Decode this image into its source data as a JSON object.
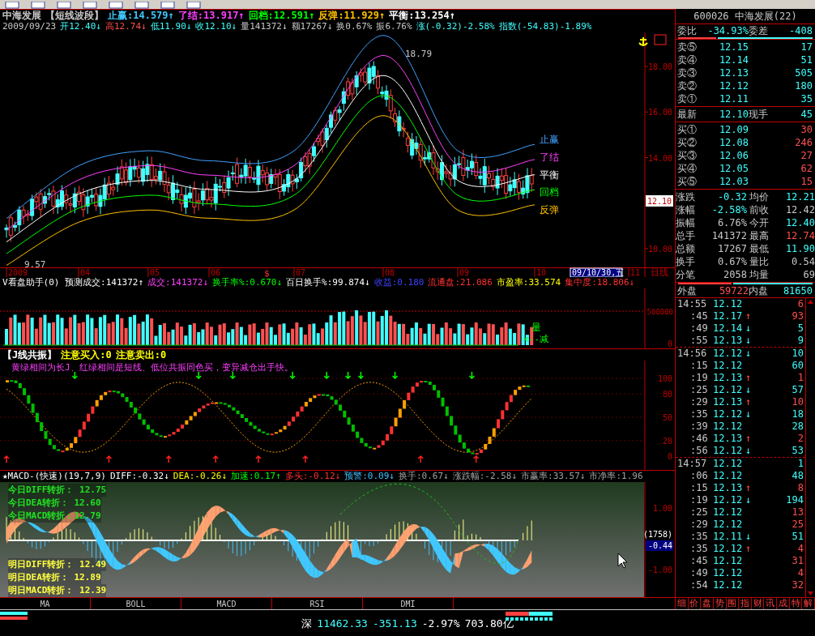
{
  "header": {
    "title": [
      {
        "text": "中海发展",
        "color": "#c8c8c8"
      },
      {
        "text": "【短线波段】",
        "color": "#c8c8c8"
      },
      {
        "text": "止赢:14.579↑",
        "color": "#40c8ff"
      },
      {
        "text": "了结:13.917↑",
        "color": "#ff40ff"
      },
      {
        "text": "回档:12.591↑",
        "color": "#00ff00"
      },
      {
        "text": "反弹:11.929↑",
        "color": "#ffc000"
      },
      {
        "text": "平衡:13.254↑",
        "color": "#ffffff"
      }
    ],
    "info": [
      {
        "text": "2009/09/23",
        "color": "#c8c8c8"
      },
      {
        "text": "开12.40↓",
        "color": "#40ffff"
      },
      {
        "text": "高12.74↓",
        "color": "#ff5050"
      },
      {
        "text": "低11.90↓",
        "color": "#40ffff"
      },
      {
        "text": "收12.10↓",
        "color": "#40ffff"
      },
      {
        "text": "量141372↓",
        "color": "#c8c8c8"
      },
      {
        "text": "额17267↓",
        "color": "#c8c8c8"
      },
      {
        "text": "换0.67%",
        "color": "#c8c8c8"
      },
      {
        "text": "振6.76%",
        "color": "#c8c8c8"
      },
      {
        "text": "涨(-0.32)-2.58%",
        "color": "#40ffff"
      },
      {
        "text": "指数(-54.83)-1.89%",
        "color": "#40ffff"
      }
    ]
  },
  "price_chart": {
    "high_label": "18.79",
    "low_label": "9.57",
    "current_price": "12.10",
    "y_ticks": [
      "18.00",
      "16.00",
      "14.00",
      "10.00"
    ],
    "band_labels": [
      {
        "text": "止赢",
        "color": "#40a0ff"
      },
      {
        "text": "了结",
        "color": "#ff40ff"
      },
      {
        "text": "平衡",
        "color": "#ffffff"
      },
      {
        "text": "回档",
        "color": "#00ff00"
      },
      {
        "text": "反弹",
        "color": "#ffc000"
      }
    ]
  },
  "date_axis": {
    "labels": [
      "2009",
      "04",
      "05",
      "06",
      "07",
      "08",
      "09",
      "10"
    ],
    "marker": "$",
    "cursor_date": "09/10/30,五",
    "last_label": "11",
    "period": "日线"
  },
  "volume_panel": {
    "header": [
      {
        "text": "V看盘助手(0) 预测成交:141372↑",
        "color": "#ffffff"
      },
      {
        "text": "成交:141372↓",
        "color": "#ff40ff"
      },
      {
        "text": "换手率%:0.670↓",
        "color": "#00ff00"
      },
      {
        "text": "百日换手%:99.874↓",
        "color": "#ffffff"
      },
      {
        "text": "收益:0.180",
        "color": "#4040ff"
      },
      {
        "text": "流通盘:21.086",
        "color": "#ff3030"
      },
      {
        "text": "市盈率:33.574",
        "color": "#ffff00"
      },
      {
        "text": "集中度:18.806↓",
        "color": "#ff3030"
      }
    ],
    "y_ticks": [
      "500000",
      "0"
    ],
    "side_label": "量",
    "side_hint": "<--减"
  },
  "j_panel": {
    "header": [
      {
        "text": "【J线共振】",
        "color": "#ffffff"
      },
      {
        "text": "注意买入:0",
        "color": "#ffff00"
      },
      {
        "text": "注意卖出:0",
        "color": "#ffff00"
      }
    ],
    "note": "黄绿相间为长J、红绿相间是短线、低位共振同色买，变异减仓出手快。",
    "y_ticks": [
      "100",
      "80",
      "50",
      "20",
      "0"
    ]
  },
  "macd_panel": {
    "header": [
      {
        "text": "★MACD-(快速)(19,7,9)",
        "color": "#ffffff"
      },
      {
        "text": "DIFF:-0.32↓",
        "color": "#ffffff"
      },
      {
        "text": "DEA:-0.26↓",
        "color": "#ffff00"
      },
      {
        "text": "加速:0.17↑",
        "color": "#00ff00"
      },
      {
        "text": "多头:-0.12↓",
        "color": "#ff3030"
      },
      {
        "text": "预警:0.09↓",
        "color": "#40c0ff"
      },
      {
        "text": "换手:0.67↓",
        "color": "#a0a0a0"
      },
      {
        "text": "涨跌幅:-2.58↓",
        "color": "#a0a0a0"
      },
      {
        "text": "市赢率:33.57↓",
        "color": "#a0a0a0"
      },
      {
        "text": "市净率:1.96",
        "color": "#a0a0a0"
      }
    ],
    "today": [
      "今日DIFF转折： 12.75",
      "今日DEA转折： 12.60",
      "今日MACD转折：12.79"
    ],
    "tomorrow": [
      "明日DIFF转折： 12.49",
      "明日DEA转折： 12.89",
      "明日MACD转折： 12.39"
    ],
    "y_ticks": [
      "1.00",
      "-1.00"
    ],
    "count": "(1758)",
    "current": "-0.44"
  },
  "indicator_tabs": [
    {
      "label": "MA",
      "selected": false
    },
    {
      "label": "BOLL",
      "selected": false
    },
    {
      "label": "MACD",
      "selected": false
    },
    {
      "label": "RSI",
      "selected": false
    },
    {
      "label": "DMI",
      "selected": false
    }
  ],
  "quote": {
    "code": "600026",
    "name": "中海发展(22)",
    "ratio": [
      "委比",
      "-34.93%",
      "委差",
      "-408"
    ],
    "asks": [
      {
        "label": "卖⑤",
        "price": "12.15",
        "volume": "17"
      },
      {
        "label": "卖④",
        "price": "12.14",
        "volume": "51"
      },
      {
        "label": "卖③",
        "price": "12.13",
        "volume": "505"
      },
      {
        "label": "卖②",
        "price": "12.12",
        "volume": "180"
      },
      {
        "label": "卖①",
        "price": "12.11",
        "volume": "35"
      }
    ],
    "latest": [
      "最新",
      "12.10",
      "现手",
      "45"
    ],
    "bids": [
      {
        "label": "买①",
        "price": "12.09",
        "volume": "30"
      },
      {
        "label": "买②",
        "price": "12.08",
        "volume": "246"
      },
      {
        "label": "买③",
        "price": "12.06",
        "volume": "27"
      },
      {
        "label": "买④",
        "price": "12.05",
        "volume": "62"
      },
      {
        "label": "买⑤",
        "price": "12.03",
        "volume": "15"
      }
    ],
    "stats": [
      {
        "label": "涨跌",
        "value": "-0.32",
        "color": "#40ffff"
      },
      {
        "label": "均价",
        "value": "12.21",
        "color": "#40ffff"
      },
      {
        "label": "涨幅",
        "value": "-2.58%",
        "color": "#40ffff"
      },
      {
        "label": "前收",
        "value": "12.42",
        "color": "#c8c8c8"
      },
      {
        "label": "振幅",
        "value": "6.76%",
        "color": "#c8c8c8"
      },
      {
        "label": "今开",
        "value": "12.40",
        "color": "#40ffff"
      },
      {
        "label": "总手",
        "value": "141372",
        "color": "#c8c8c8"
      },
      {
        "label": "最高",
        "value": "12.74",
        "color": "#ff5050"
      },
      {
        "label": "总额",
        "value": "17267",
        "color": "#c8c8c8"
      },
      {
        "label": "最低",
        "value": "11.90",
        "color": "#40ffff"
      },
      {
        "label": "换手",
        "value": "0.67%",
        "color": "#c8c8c8"
      },
      {
        "label": "量比",
        "value": "0.54",
        "color": "#c8c8c8"
      },
      {
        "label": "分笔",
        "value": "2058",
        "color": "#c8c8c8"
      },
      {
        "label": "均量",
        "value": "69",
        "color": "#c8c8c8"
      }
    ],
    "outer": [
      "外盘",
      "59722",
      "内盘",
      "81650"
    ],
    "tick_groups": [
      {
        "rows": [
          {
            "time": "14:55",
            "price": "12.12",
            "volume": "6",
            "color": "#ff5050"
          },
          {
            "time": ":45",
            "price": "12.17",
            "arrow": "↑",
            "volume": "93",
            "color": "#ff5050"
          },
          {
            "time": ":49",
            "price": "12.14",
            "arrow": "↓",
            "volume": "5",
            "color": "#40ffff"
          },
          {
            "time": ":55",
            "price": "12.13",
            "arrow": "↓",
            "volume": "9",
            "color": "#40ffff"
          }
        ]
      },
      {
        "rows": [
          {
            "time": "14:56",
            "price": "12.12",
            "arrow": "↓",
            "volume": "10",
            "color": "#40ffff"
          },
          {
            "time": ":15",
            "price": "12.12",
            "volume": "60",
            "color": "#40ffff"
          },
          {
            "time": ":19",
            "price": "12.13",
            "arrow": "↑",
            "volume": "1",
            "color": "#ff5050"
          },
          {
            "time": ":25",
            "price": "12.12",
            "arrow": "↓",
            "volume": "57",
            "color": "#40ffff"
          },
          {
            "time": ":29",
            "price": "12.13",
            "arrow": "↑",
            "volume": "10",
            "color": "#ff5050"
          },
          {
            "time": ":35",
            "price": "12.12",
            "arrow": "↓",
            "volume": "18",
            "color": "#40ffff"
          },
          {
            "time": ":39",
            "price": "12.12",
            "volume": "28",
            "color": "#40ffff"
          },
          {
            "time": ":46",
            "price": "12.13",
            "arrow": "↑",
            "volume": "2",
            "color": "#ff5050"
          },
          {
            "time": ":56",
            "price": "12.12",
            "arrow": "↓",
            "volume": "53",
            "color": "#40ffff"
          }
        ]
      },
      {
        "rows": [
          {
            "time": "14:57",
            "price": "12.12",
            "volume": "1",
            "color": "#40ffff"
          },
          {
            "time": ":06",
            "price": "12.12",
            "volume": "48",
            "color": "#40ffff"
          },
          {
            "time": ":15",
            "price": "12.13",
            "arrow": "↑",
            "volume": "8",
            "color": "#ff5050"
          },
          {
            "time": ":19",
            "price": "12.12",
            "arrow": "↓",
            "volume": "194",
            "color": "#40ffff"
          },
          {
            "time": ":25",
            "price": "12.12",
            "volume": "13",
            "color": "#ff5050"
          },
          {
            "time": ":29",
            "price": "12.12",
            "volume": "25",
            "color": "#ff5050"
          },
          {
            "time": ":35",
            "price": "12.11",
            "arrow": "↓",
            "volume": "51",
            "color": "#40ffff"
          },
          {
            "time": ":35",
            "price": "12.12",
            "arrow": "↑",
            "volume": "4",
            "color": "#ff5050"
          },
          {
            "time": ":45",
            "price": "12.12",
            "volume": "31",
            "color": "#ff5050"
          },
          {
            "time": ":49",
            "price": "12.12",
            "volume": "4",
            "color": "#ff5050"
          },
          {
            "time": ":54",
            "price": "12.12",
            "volume": "32",
            "color": "#ff5050"
          }
        ]
      }
    ],
    "side_tabs": [
      "细",
      "价",
      "盘",
      "势",
      "围",
      "指",
      "财",
      "讯",
      "成",
      "特",
      "解"
    ]
  },
  "status_bar": [
    {
      "text": "深",
      "color": "#ffffff"
    },
    {
      "text": "11462.33",
      "color": "#40ffff"
    },
    {
      "text": "-351.13",
      "color": "#40ffff"
    },
    {
      "text": "-2.97%",
      "color": "#ffffff"
    },
    {
      "text": "703.80亿",
      "color": "#ffffff"
    }
  ]
}
